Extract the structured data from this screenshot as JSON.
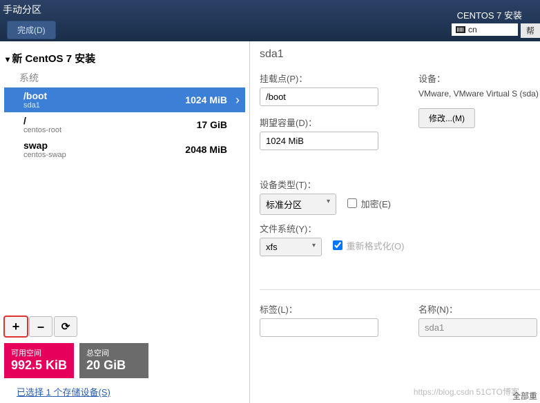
{
  "top": {
    "title": "手动分区",
    "done": "完成(D)",
    "product": "CENTOS 7 安装",
    "lang": "cn",
    "help": "帮"
  },
  "left": {
    "header": "新 CentOS 7 安装",
    "system_label": "系统",
    "mounts": [
      {
        "mp": "/boot",
        "dev": "sda1",
        "size": "1024 MiB"
      },
      {
        "mp": "/",
        "dev": "centos-root",
        "size": "17 GiB"
      },
      {
        "mp": "swap",
        "dev": "centos-swap",
        "size": "2048 MiB"
      }
    ],
    "buttons": {
      "add": "+",
      "remove": "–",
      "refresh": "⟳"
    },
    "avail": {
      "label": "可用空间",
      "value": "992.5 KiB"
    },
    "total": {
      "label": "总空间",
      "value": "20 GiB"
    },
    "storage_link": "已选择 1 个存储设备(S)"
  },
  "right": {
    "title": "sda1",
    "mount_lbl": "挂载点(P)：",
    "mount_val": "/boot",
    "cap_lbl": "期望容量(D)：",
    "cap_val": "1024 MiB",
    "dev_lbl": "设备：",
    "dev_txt": "VMware, VMware Virtual S (sda)",
    "modify": "修改...(M)",
    "devtype_lbl": "设备类型(T)：",
    "devtype_val": "标准分区",
    "encrypt": "加密(E)",
    "fs_lbl": "文件系统(Y)：",
    "fs_val": "xfs",
    "reformat": "重新格式化(O)",
    "label_lbl": "标签(L)：",
    "label_val": "",
    "name_lbl": "名称(N)：",
    "name_val": "sda1",
    "footer": "全部重"
  },
  "watermark": "https://blog.csdn 51CTO博客"
}
